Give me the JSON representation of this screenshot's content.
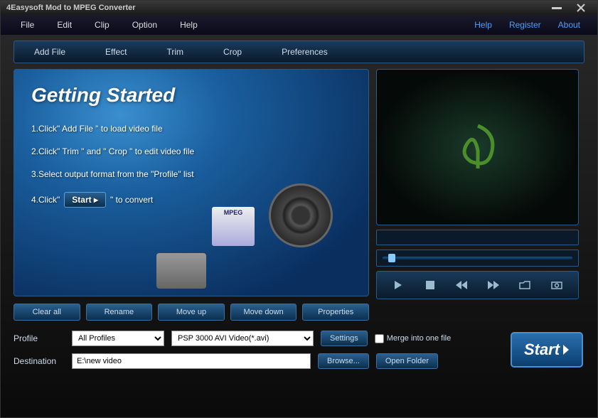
{
  "titlebar": {
    "title": "4Easysoft Mod to MPEG Converter"
  },
  "menubar": {
    "items": [
      "File",
      "Edit",
      "Clip",
      "Option",
      "Help"
    ],
    "links": [
      "Help",
      "Register",
      "About"
    ]
  },
  "toolbar": {
    "items": [
      "Add File",
      "Effect",
      "Trim",
      "Crop",
      "Preferences"
    ]
  },
  "getting_started": {
    "title": "Getting Started",
    "step1": "1.Click\" Add File \" to load video file",
    "step2": "2.Click\" Trim \" and \" Crop \" to edit video file",
    "step3": "3.Select output format from the \"Profile\" list",
    "step4_prefix": "4.Click\"",
    "step4_button": "Start ▸",
    "step4_suffix": "\" to convert",
    "mpeg_label": "MPEG"
  },
  "file_buttons": [
    "Clear all",
    "Rename",
    "Move up",
    "Move down",
    "Properties"
  ],
  "bottom": {
    "profile_label": "Profile",
    "profile_select": "All Profiles",
    "format_select": "PSP 3000 AVI Video(*.avi)",
    "settings_btn": "Settings",
    "merge_label": "Merge into one file",
    "dest_label": "Destination",
    "dest_value": "E:\\new video",
    "browse_btn": "Browse...",
    "open_folder_btn": "Open Folder",
    "start_btn": "Start"
  }
}
